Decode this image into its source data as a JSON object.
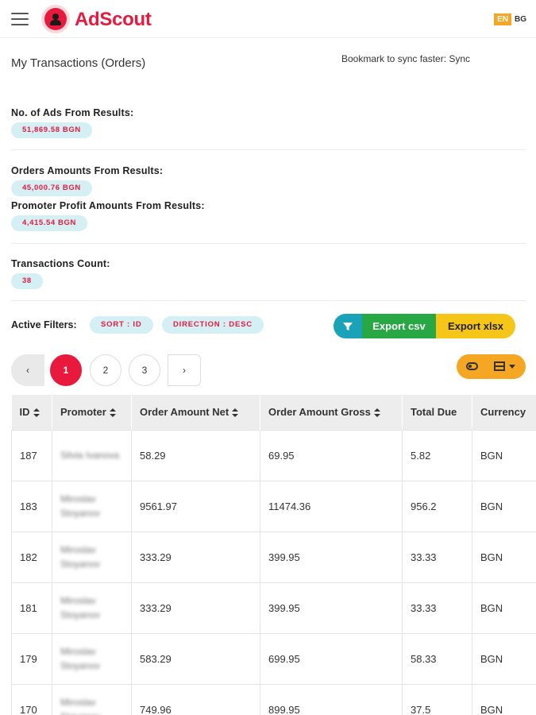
{
  "header": {
    "logo_text_1": "Ad",
    "logo_text_2": "Scout",
    "lang_active": "EN",
    "lang_other": "BG"
  },
  "page": {
    "title": "My Transactions (Orders)",
    "bookmark": "Bookmark to sync faster: Sync"
  },
  "stats": {
    "ads_label": "No. of Ads From Results:",
    "ads_value": "51,869.58 BGN",
    "orders_label": "Orders Amounts From Results:",
    "orders_value": "45,000.76 BGN",
    "profit_label": "Promoter Profit Amounts From Results:",
    "profit_value": "4,415.54 BGN",
    "count_label": "Transactions Count:",
    "count_value": "38"
  },
  "filters": {
    "label": "Active Filters:",
    "chips": [
      "SORT : ID",
      "DIRECTION : DESC"
    ],
    "export_csv": "Export csv",
    "export_xlsx": "Export xlsx"
  },
  "pagination": {
    "prev": "‹",
    "pages": [
      "1",
      "2",
      "3"
    ],
    "next": "›",
    "active_page": "1"
  },
  "table": {
    "headers": [
      "ID",
      "Promoter",
      "Order Amount Net",
      "Order Amount Gross",
      "Total Due",
      "Currency"
    ],
    "rows": [
      [
        "187",
        "Silvia Ivanova",
        "58.29",
        "69.95",
        "5.82",
        "BGN"
      ],
      [
        "183",
        "Miroslav Stoyanov",
        "9561.97",
        "11474.36",
        "956.2",
        "BGN"
      ],
      [
        "182",
        "Miroslav Stoyanov",
        "333.29",
        "399.95",
        "33.33",
        "BGN"
      ],
      [
        "181",
        "Miroslav Stoyanov",
        "333.29",
        "399.95",
        "33.33",
        "BGN"
      ],
      [
        "179",
        "Miroslav Stoyanov",
        "583.29",
        "699.95",
        "58.33",
        "BGN"
      ],
      [
        "170",
        "Miroslav Stoyanov",
        "749.96",
        "899.95",
        "37.5",
        "BGN"
      ]
    ]
  },
  "colors": {
    "brand": "#e8193c",
    "pill_bg": "#d4f0f4",
    "filter_btn": "#1aa3b8",
    "csv_btn": "#28a745",
    "xlsx_btn": "#f5c518",
    "view_btn": "#f5a623"
  },
  "icons": {
    "menu": "hamburger-icon",
    "filter": "filter-icon",
    "toggle": "toggle-icon",
    "columns": "columns-icon"
  }
}
